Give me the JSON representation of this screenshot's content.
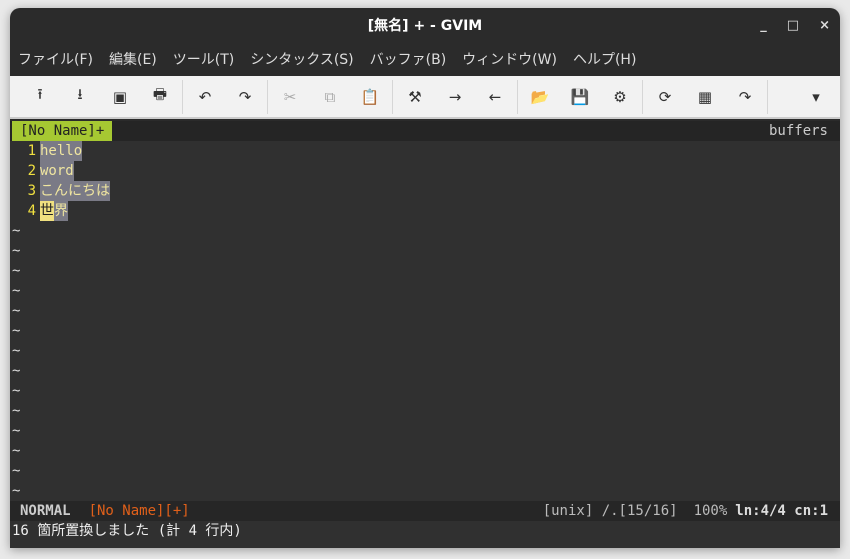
{
  "window": {
    "title": "[無名] + - GVIM",
    "minimize": "_",
    "maximize": "□",
    "close": "×"
  },
  "menu": [
    "ファイル(F)",
    "編集(E)",
    "ツール(T)",
    "シンタックス(S)",
    "バッファ(B)",
    "ウィンドウ(W)",
    "ヘルプ(H)"
  ],
  "toolbar": [
    {
      "name": "open-icon",
      "glyph": "⭱"
    },
    {
      "name": "save-icon",
      "glyph": "⭳"
    },
    {
      "name": "save-all-icon",
      "glyph": "▣"
    },
    {
      "name": "print-icon",
      "glyph": "🖶"
    },
    {
      "sep": true
    },
    {
      "name": "undo-icon",
      "glyph": "↶"
    },
    {
      "name": "redo-icon",
      "glyph": "↷"
    },
    {
      "sep": true
    },
    {
      "name": "cut-icon",
      "glyph": "✂",
      "disabled": true
    },
    {
      "name": "copy-icon",
      "glyph": "⧉",
      "disabled": true
    },
    {
      "name": "paste-icon",
      "glyph": "📋"
    },
    {
      "sep": true
    },
    {
      "name": "replace-icon",
      "glyph": "⚒"
    },
    {
      "name": "find-next-icon",
      "glyph": "→"
    },
    {
      "name": "find-prev-icon",
      "glyph": "←"
    },
    {
      "sep": true
    },
    {
      "name": "load-session-icon",
      "glyph": "📂"
    },
    {
      "name": "save-session-icon",
      "glyph": "💾"
    },
    {
      "name": "run-script-icon",
      "glyph": "⚙"
    },
    {
      "sep": true
    },
    {
      "name": "make-icon",
      "glyph": "⟳"
    },
    {
      "name": "ctags-icon",
      "glyph": "▦"
    },
    {
      "name": "jump-tag-icon",
      "glyph": "↷"
    },
    {
      "sep": true
    }
  ],
  "tabline": {
    "tab": "[No Name]+",
    "right": "buffers"
  },
  "lines": [
    {
      "n": "1",
      "text": "hello"
    },
    {
      "n": "2",
      "text": "word"
    },
    {
      "n": "3",
      "text": "こんにちは"
    },
    {
      "n": "4",
      "cursor": "世",
      "text": "界"
    }
  ],
  "tilde": "~",
  "status": {
    "mode": "NORMAL",
    "file": "[No Name][+]",
    "format": "[unix] /.[15/16]",
    "percent": "100%",
    "pos": "ln:4/4 cn:1"
  },
  "cmdline": "16 箇所置換しました (計 4 行内)"
}
